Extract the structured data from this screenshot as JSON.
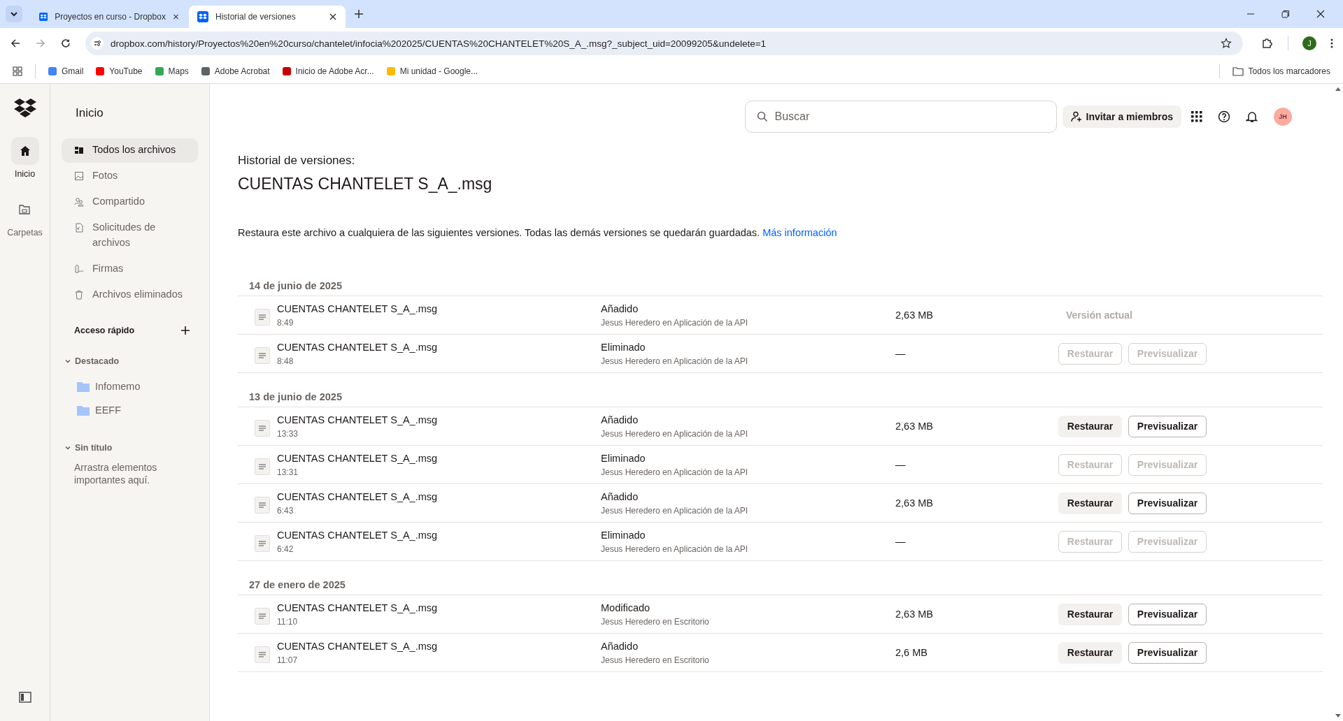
{
  "browser": {
    "tabs": [
      {
        "title": "Proyectos en curso - Dropbox",
        "selected": false
      },
      {
        "title": "Historial de versiones",
        "selected": true
      }
    ],
    "url": "dropbox.com/history/Proyectos%20en%20curso/chantelet/infocia%202025/CUENTAS%20CHANTELET%20S_A_.msg?_subject_uid=20099205&undelete=1",
    "profile_initial": "J",
    "bookmarks": [
      "Gmail",
      "YouTube",
      "Maps",
      "Adobe Acrobat",
      "Inicio de Adobe Acr...",
      "Mi unidad - Google..."
    ],
    "all_bookmarks": "Todos los marcadores"
  },
  "rail": {
    "items": [
      {
        "label": "Inicio",
        "selected": true
      },
      {
        "label": "Carpetas",
        "selected": false
      }
    ]
  },
  "sidebar": {
    "title": "Inicio",
    "items": [
      {
        "label": "Todos los archivos",
        "selected": true
      },
      {
        "label": "Fotos",
        "selected": false
      },
      {
        "label": "Compartido",
        "selected": false
      },
      {
        "label": "Solicitudes de archivos",
        "selected": false
      },
      {
        "label": "Firmas",
        "selected": false
      },
      {
        "label": "Archivos eliminados",
        "selected": false
      }
    ],
    "quick_access": "Acceso rápido",
    "groups": [
      {
        "title": "Destacado",
        "expanded": true,
        "folders": [
          "Infomemo",
          "EEFF"
        ]
      },
      {
        "title": "Sin título",
        "expanded": true,
        "hint": "Arrastra elementos importantes aquí."
      }
    ]
  },
  "header": {
    "search_placeholder": "Buscar",
    "invite": "Invitar a miembros",
    "avatar": "JH"
  },
  "page": {
    "subtitle": "Historial de versiones:",
    "filename": "CUENTAS CHANTELET S_A_.msg",
    "description": "Restaura este archivo a cualquiera de las siguientes versiones. Todas las demás versiones se quedarán guardadas.",
    "link": "Más información"
  },
  "groups": [
    {
      "date": "14 de junio de 2025",
      "versions": [
        {
          "name": "CUENTAS CHANTELET S_A_.msg",
          "time": "8:49",
          "action": "Añadido",
          "by": "Jesus Heredero en Aplicación de la API",
          "size": "2,63 MB",
          "current_label": "Versión actual"
        },
        {
          "name": "CUENTAS CHANTELET S_A_.msg",
          "time": "8:48",
          "action": "Eliminado",
          "by": "Jesus Heredero en Aplicación de la API",
          "size": "—",
          "buttons": [
            {
              "label": "Restaurar",
              "disabled": true
            },
            {
              "label": "Previsualizar",
              "disabled": true
            }
          ]
        }
      ]
    },
    {
      "date": "13 de junio de 2025",
      "versions": [
        {
          "name": "CUENTAS CHANTELET S_A_.msg",
          "time": "13:33",
          "action": "Añadido",
          "by": "Jesus Heredero en Aplicación de la API",
          "size": "2,63 MB",
          "buttons": [
            {
              "label": "Restaurar",
              "disabled": false
            },
            {
              "label": "Previsualizar",
              "disabled": false
            }
          ]
        },
        {
          "name": "CUENTAS CHANTELET S_A_.msg",
          "time": "13:31",
          "action": "Eliminado",
          "by": "Jesus Heredero en Aplicación de la API",
          "size": "—",
          "buttons": [
            {
              "label": "Restaurar",
              "disabled": true
            },
            {
              "label": "Previsualizar",
              "disabled": true
            }
          ]
        },
        {
          "name": "CUENTAS CHANTELET S_A_.msg",
          "time": "6:43",
          "action": "Añadido",
          "by": "Jesus Heredero en Aplicación de la API",
          "size": "2,63 MB",
          "buttons": [
            {
              "label": "Restaurar",
              "disabled": false
            },
            {
              "label": "Previsualizar",
              "disabled": false
            }
          ]
        },
        {
          "name": "CUENTAS CHANTELET S_A_.msg",
          "time": "6:42",
          "action": "Eliminado",
          "by": "Jesus Heredero en Aplicación de la API",
          "size": "—",
          "buttons": [
            {
              "label": "Restaurar",
              "disabled": true
            },
            {
              "label": "Previsualizar",
              "disabled": true
            }
          ]
        }
      ]
    },
    {
      "date": "27 de enero de 2025",
      "versions": [
        {
          "name": "CUENTAS CHANTELET S_A_.msg",
          "time": "11:10",
          "action": "Modificado",
          "by": "Jesus Heredero en Escritorio",
          "size": "2,63 MB",
          "buttons": [
            {
              "label": "Restaurar",
              "disabled": false
            },
            {
              "label": "Previsualizar",
              "disabled": false
            }
          ]
        },
        {
          "name": "CUENTAS CHANTELET S_A_.msg",
          "time": "11:07",
          "action": "Añadido",
          "by": "Jesus Heredero en Escritorio",
          "size": "2,6 MB",
          "buttons": [
            {
              "label": "Restaurar",
              "disabled": false
            },
            {
              "label": "Previsualizar",
              "disabled": false
            }
          ]
        }
      ]
    }
  ]
}
